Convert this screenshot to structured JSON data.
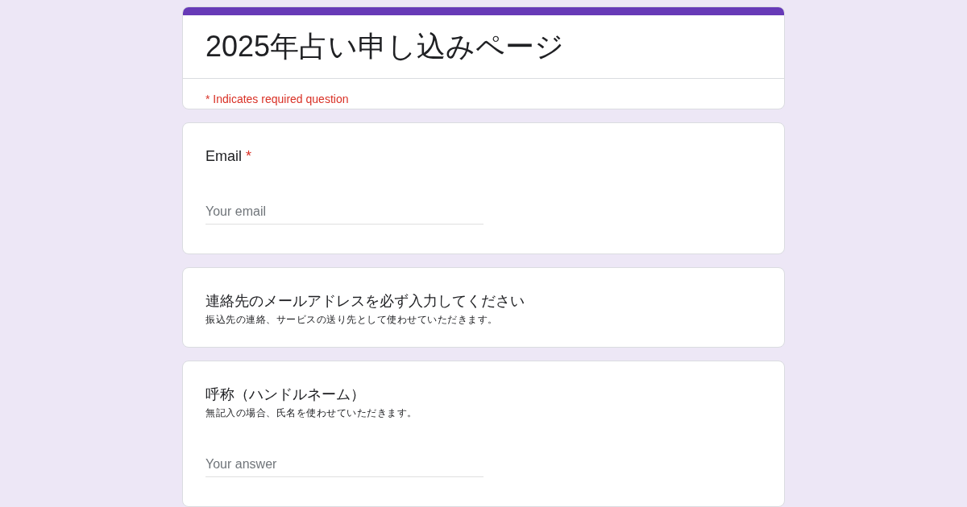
{
  "form": {
    "title": "2025年占い申し込みページ",
    "required_note": "* Indicates required question"
  },
  "items": [
    {
      "kind": "question",
      "title": "Email",
      "required_mark": "*",
      "placeholder": "Your email"
    },
    {
      "kind": "section",
      "title": "連絡先のメールアドレスを必ず入力してください",
      "description": "振込先の連絡、サービスの送り先として使わせていただきます。"
    },
    {
      "kind": "question",
      "title": "呼称（ハンドルネーム）",
      "description": "無記入の場合、氏名を使わせていただきます。",
      "placeholder": "Your answer"
    }
  ]
}
